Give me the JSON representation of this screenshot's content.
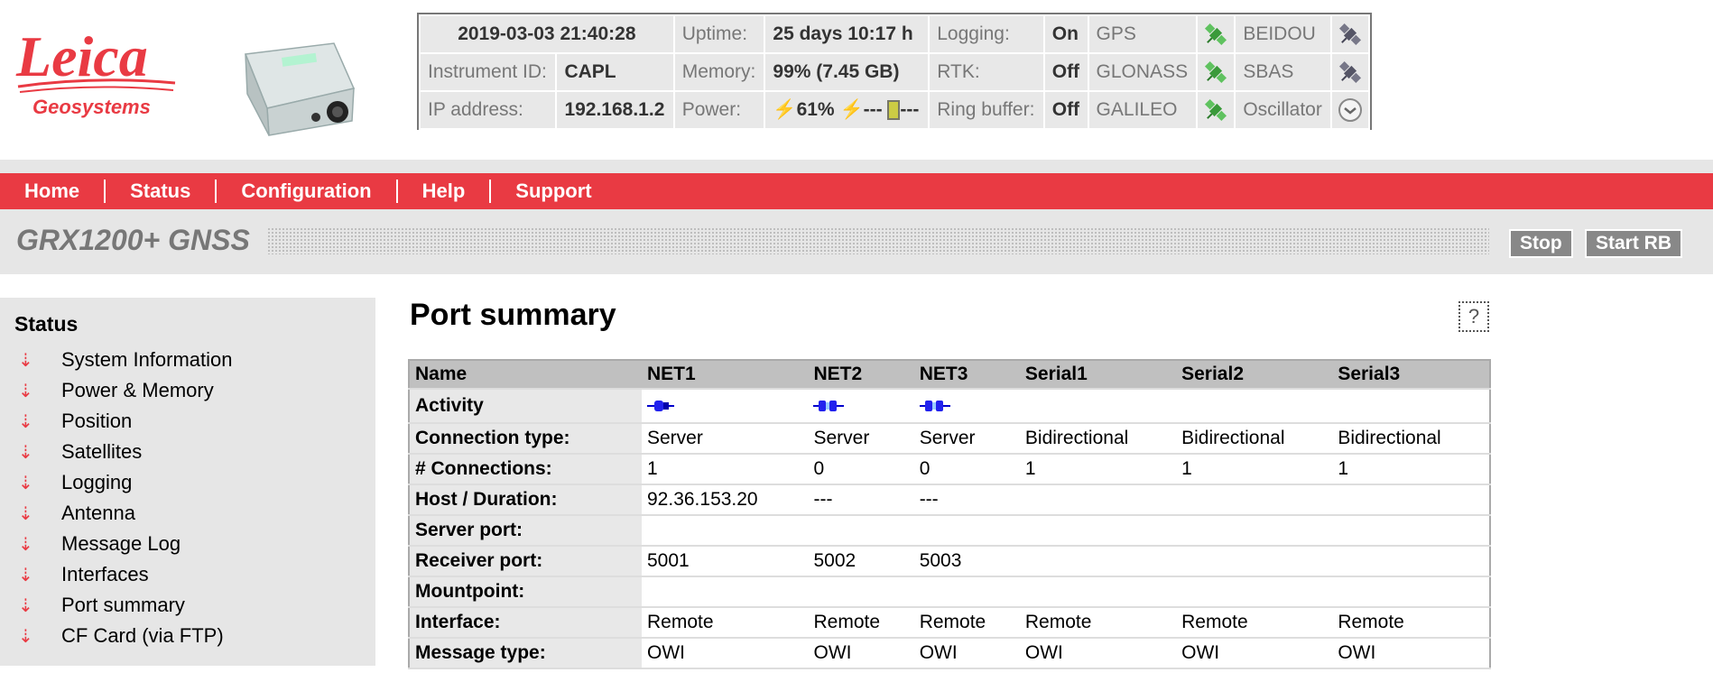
{
  "brand": {
    "line1": "Leica",
    "line2": "Geosystems",
    "color": "#e93a43"
  },
  "status": {
    "datetime": "2019-03-03 21:40:28",
    "instrument_id_label": "Instrument ID:",
    "instrument_id": "CAPL",
    "ip_label": "IP address:",
    "ip": "192.168.1.2",
    "uptime_label": "Uptime:",
    "uptime": "25 days 10:17 h",
    "memory_label": "Memory:",
    "memory": "99% (7.45 GB)",
    "power_label": "Power:",
    "power_1": "61%",
    "power_2": "---",
    "power_3": "---",
    "logging_label": "Logging:",
    "logging": "On",
    "rtk_label": "RTK:",
    "rtk": "Off",
    "ringbuffer_label": "Ring buffer:",
    "ringbuffer": "Off",
    "gps": "GPS",
    "glonass": "GLONASS",
    "galileo": "GALILEO",
    "beidou": "BEIDOU",
    "sbas": "SBAS",
    "oscillator": "Oscillator"
  },
  "menu": [
    "Home",
    "Status",
    "Configuration",
    "Help",
    "Support"
  ],
  "device_name": "GRX1200+ GNSS",
  "buttons": {
    "stop": "Stop",
    "start_rb": "Start RB"
  },
  "sidebar": {
    "title": "Status",
    "items": [
      "System Information",
      "Power & Memory",
      "Position",
      "Satellites",
      "Logging",
      "Antenna",
      "Message Log",
      "Interfaces",
      "Port summary",
      "CF Card (via FTP)"
    ]
  },
  "page": {
    "title": "Port summary",
    "help": "?"
  },
  "table": {
    "headers": [
      "Name",
      "NET1",
      "NET2",
      "NET3",
      "Serial1",
      "Serial2",
      "Serial3"
    ],
    "activity_label": "Activity",
    "rows": [
      {
        "label": "Connection type:",
        "cells": [
          "Server",
          "Server",
          "Server",
          "Bidirectional",
          "Bidirectional",
          "Bidirectional"
        ]
      },
      {
        "label": "# Connections:",
        "cells": [
          "1",
          "0",
          "0",
          "1",
          "1",
          "1"
        ]
      },
      {
        "label": "Host / Duration:",
        "cells": [
          "92.36.153.20",
          "---",
          "---",
          "",
          "",
          ""
        ]
      },
      {
        "label": "Server port:",
        "cells": [
          "",
          "",
          "",
          "",
          "",
          ""
        ]
      },
      {
        "label": "Receiver port:",
        "cells": [
          "5001",
          "5002",
          "5003",
          "",
          "",
          ""
        ]
      },
      {
        "label": "Mountpoint:",
        "cells": [
          "",
          "",
          "",
          "",
          "",
          ""
        ]
      },
      {
        "label": "Interface:",
        "cells": [
          "Remote",
          "Remote",
          "Remote",
          "Remote",
          "Remote",
          "Remote"
        ]
      },
      {
        "label": "Message type:",
        "cells": [
          "OWI",
          "OWI",
          "OWI",
          "OWI",
          "OWI",
          "OWI"
        ]
      }
    ]
  },
  "icons": {
    "satellite_active": "satellite-green-icon",
    "satellite_inactive": "satellite-grey-icon",
    "oscillator": "clock-icon",
    "net_connected": "plug-connected-icon",
    "net_waiting": "plug-waiting-icon"
  }
}
